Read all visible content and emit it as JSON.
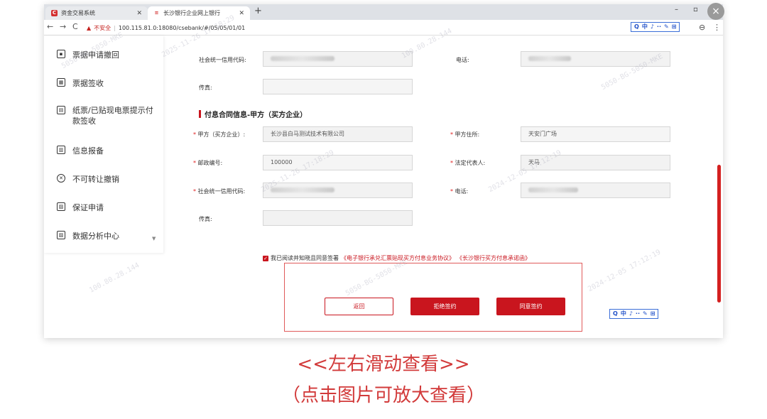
{
  "browser": {
    "tabs": [
      {
        "label": "资金交易系统",
        "favicon": "C"
      },
      {
        "label": "长沙银行企业网上银行",
        "favicon": "≡"
      }
    ],
    "new_tab": "+",
    "nav": {
      "back": "←",
      "forward": "→",
      "reload": "C"
    },
    "address": {
      "warning": "不安全",
      "url": "100.115.81.0:18080/csebank/#/05/05/01/01"
    },
    "ime_toolbar": [
      "Q",
      "中",
      "♪",
      "··",
      "✎",
      "⊞"
    ],
    "window_controls": {
      "minimize": "–",
      "maximize": "▫"
    },
    "profile_icon": "⊖"
  },
  "sidebar": {
    "items": [
      {
        "label": "票据申请撤回",
        "icon": "document-icon",
        "glyph": "▪"
      },
      {
        "label": "票据签收",
        "icon": "calendar-icon",
        "glyph": "▦"
      },
      {
        "label": "纸票/已贴现电票提示付款签收",
        "icon": "ticket-icon",
        "glyph": "▤"
      },
      {
        "label": "信息报备",
        "icon": "report-icon",
        "glyph": "▥"
      },
      {
        "label": "不可转让撤销",
        "icon": "cancel-icon",
        "glyph": "✕"
      },
      {
        "label": "保证申请",
        "icon": "image-icon",
        "glyph": "▨"
      },
      {
        "label": "数据分析中心",
        "icon": "image-icon",
        "glyph": "▨"
      }
    ],
    "expand_caret": "▼"
  },
  "form": {
    "top": {
      "credit_code_label": "社会统一信用代码:",
      "phone_label": "电话:",
      "fax_label": "传真:"
    },
    "section_title": "付息合同信息-甲方（买方企业）",
    "required_mark": "*",
    "party_a_label": "甲方（买方企业）:",
    "party_a_value": "长沙县白马测试技术有限公司",
    "address_label": "甲方住所:",
    "address_value": "天安门广场",
    "postcode_label": "邮政编号:",
    "postcode_value": "100000",
    "legal_rep_label": "法定代表人:",
    "legal_rep_value": "天马",
    "credit_code_label": "社会统一信用代码:",
    "phone_label": "电话:",
    "fax_label": "传真:"
  },
  "agreement": {
    "checkbox": "✓",
    "text": "我已阅读并知晓且同意签署",
    "link1": "《电子银行承兑汇票贴现买方付息业务协议》",
    "link2": "《长沙银行买方付息承诺函》"
  },
  "buttons": {
    "back": "返回",
    "reject": "拒绝签约",
    "accept": "同意签约"
  },
  "watermark": {
    "lines": [
      "5050-BG-5050-MKE",
      "100.80.28.144",
      "2025-11-26 17:18:29",
      "2024-12-05 17:12:19"
    ]
  },
  "overlay_close": "×",
  "captions": {
    "line1": "<<左右滑动查看>>",
    "line2": "（点击图片可放大查看）"
  },
  "colors": {
    "accent": "#c9151e",
    "caption": "#d23a3a"
  }
}
